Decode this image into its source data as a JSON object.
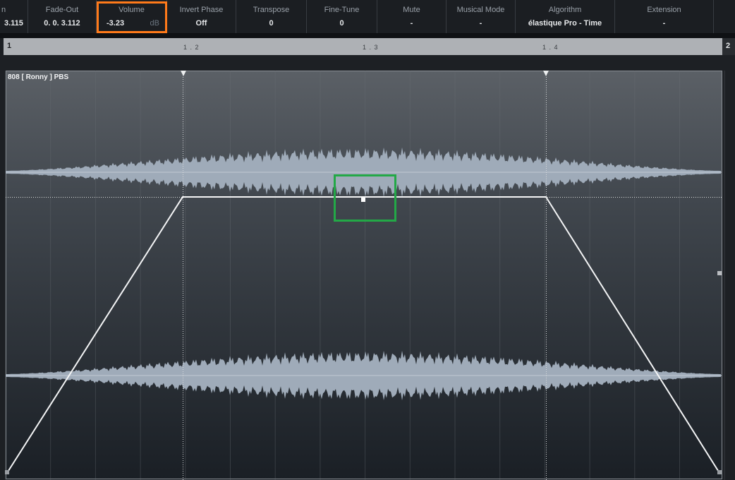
{
  "infoline": {
    "cells": [
      {
        "id": "fade-in",
        "label": "n",
        "value": "3.115"
      },
      {
        "id": "fade-out",
        "label": "Fade-Out",
        "value": "0. 0. 3.112"
      },
      {
        "id": "volume",
        "label": "Volume",
        "value": "-3.23",
        "unit": "dB"
      },
      {
        "id": "invert-phase",
        "label": "Invert Phase",
        "value": "Off"
      },
      {
        "id": "transpose",
        "label": "Transpose",
        "value": "0"
      },
      {
        "id": "fine-tune",
        "label": "Fine-Tune",
        "value": "0"
      },
      {
        "id": "mute",
        "label": "Mute",
        "value": "-"
      },
      {
        "id": "musical-mode",
        "label": "Musical Mode",
        "value": "-"
      },
      {
        "id": "algorithm",
        "label": "Algorithm",
        "value": "élastique Pro - Time"
      },
      {
        "id": "extension",
        "label": "Extension",
        "value": "-"
      }
    ],
    "highlight_color": "#ff7a1a"
  },
  "ruler": {
    "labels": [
      "1",
      "1 . 2",
      "1 . 3",
      "1 . 4"
    ],
    "end_label": "2"
  },
  "clip": {
    "name": "808 [ Ronny ] PBS",
    "focus_color": "#23a847"
  }
}
